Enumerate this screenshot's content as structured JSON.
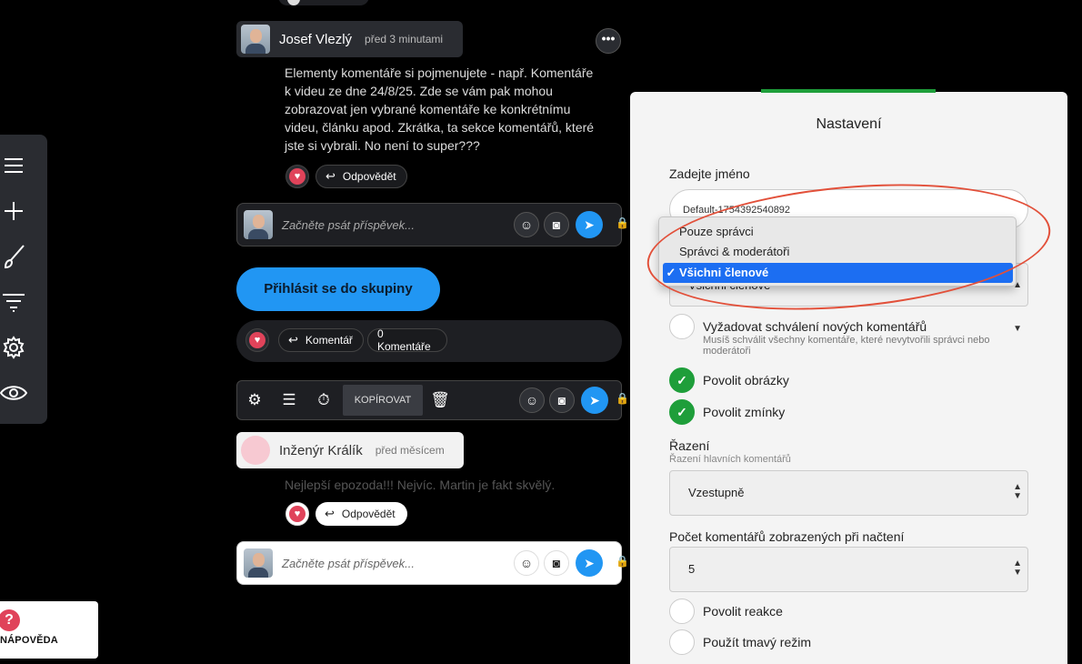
{
  "left_toolbar": {
    "icons": [
      "menu-icon",
      "plus-icon",
      "brush-icon",
      "filter-icon",
      "gear-icon",
      "eye-icon"
    ]
  },
  "help": {
    "label": "NÁPOVĚDA",
    "symbol": "?"
  },
  "comment1": {
    "author": "Josef Vlezlý",
    "time": "před 3 minutami",
    "more": "•••",
    "text": "Elementy komentáře si pojmenujete - např. Komentáře k videu ze dne 24/8/25. Zde se vám pak mohou zobrazovat jen vybrané komentáře ke konkrétnímu videu, článku apod. Zkrátka, ta sekce komentářů, které jste si vybrali. No není to super???",
    "reply_label": "Odpovědět"
  },
  "composer": {
    "placeholder": "Začněte psát příspěvek..."
  },
  "join_button": "Přihlásit se do skupiny",
  "reaction_bar": {
    "comment_label": "Komentář",
    "count_label": "0 Komentáře"
  },
  "edit_toolbar": {
    "copy_label": "KOPÍROVAT"
  },
  "comment2": {
    "author": "Inženýr Králík",
    "time": "před měsícem",
    "text": "Nejlepší epozoda!!! Nejvíc. Martin je fakt skvělý.",
    "reply_label": "Odpovědět"
  },
  "settings": {
    "title": "Nastavení",
    "name_label": "Zadejte jméno",
    "name_value": "Default-1754392540892",
    "permission_value": "Všichni členové",
    "require_approval_label": "Vyžadovat schválení nových komentářů",
    "require_approval_sub": "Musíš schválit všechny komentáře, které nevytvořili správci nebo moderátoři",
    "allow_images_label": "Povolit obrázky",
    "allow_mentions_label": "Povolit zmínky",
    "sort_label": "Řazení",
    "sort_sub": "Řazení hlavních komentářů",
    "sort_value": "Vzestupně",
    "count_label": "Počet komentářů zobrazených při načtení",
    "count_value": "5",
    "allow_reactions_label": "Povolit reakce",
    "dark_mode_label": "Použít tmavý režim"
  },
  "dropdown": {
    "options": [
      "Pouze správci",
      "Správci & moderátoři",
      "Všichni členové"
    ],
    "selected": "Všichni členové"
  },
  "colors": {
    "accent_blue": "#2196f3",
    "heart_red": "#e0435a",
    "success_green": "#1e9e3a",
    "annotation_red": "#e2503a"
  }
}
